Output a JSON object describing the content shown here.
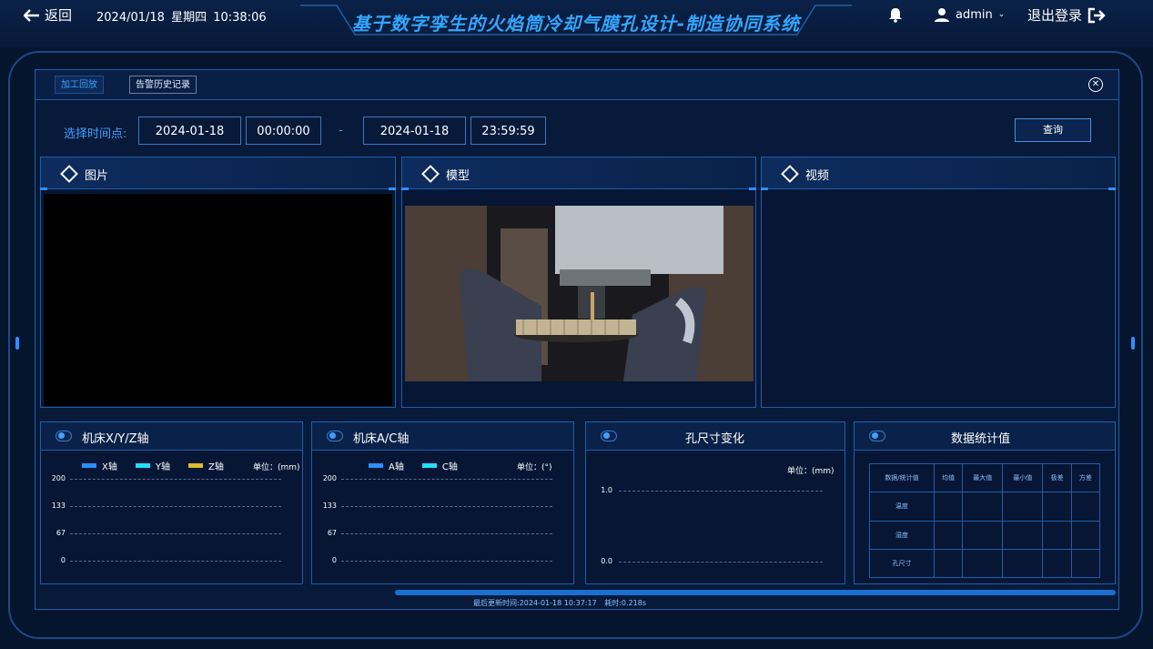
{
  "header": {
    "back_label": "返回",
    "date": "2024/01/18",
    "weekday": "星期四",
    "time": "10:38:06",
    "title": "基于数字孪生的火焰筒冷却气膜孔设计-制造协同系统",
    "user": "admin",
    "logout_label": "退出登录"
  },
  "tabs": {
    "active": "加工回放",
    "alarm": "告警历史记录"
  },
  "time_filter": {
    "label": "选择时间点:",
    "start_date": "2024-01-18",
    "start_time": "00:00:00",
    "separator": "-",
    "end_date": "2024-01-18",
    "end_time": "23:59:59",
    "query_label": "查询"
  },
  "cards": {
    "image": "图片",
    "model": "模型",
    "video": "视频"
  },
  "charts": {
    "xyz": {
      "title": "机床X/Y/Z轴",
      "unit": "单位：(mm)"
    },
    "ac": {
      "title": "机床A/C轴",
      "unit": "单位：(°)"
    },
    "hole": {
      "title": "孔尺寸变化",
      "unit": "单位：(mm)"
    },
    "stats": {
      "title": "数据统计值"
    }
  },
  "chart_data": [
    {
      "type": "line",
      "title": "机床X/Y/Z轴",
      "ylabel": "单位：(mm)",
      "ylim": [
        0,
        200
      ],
      "yticks": [
        200,
        133,
        67,
        0
      ],
      "series": [
        {
          "name": "X轴",
          "color": "#2b8fff",
          "values": []
        },
        {
          "name": "Y轴",
          "color": "#22e0ff",
          "values": []
        },
        {
          "name": "Z轴",
          "color": "#e0b830",
          "values": []
        }
      ],
      "grid": true,
      "legend": "top"
    },
    {
      "type": "line",
      "title": "机床A/C轴",
      "ylabel": "单位：(°)",
      "ylim": [
        0,
        200
      ],
      "yticks": [
        200,
        133,
        67,
        0
      ],
      "series": [
        {
          "name": "A轴",
          "color": "#2b8fff",
          "values": []
        },
        {
          "name": "C轴",
          "color": "#22e0ff",
          "values": []
        }
      ],
      "grid": true,
      "legend": "top"
    },
    {
      "type": "line",
      "title": "孔尺寸变化",
      "ylabel": "单位：(mm)",
      "ylim": [
        0,
        1
      ],
      "yticks": [
        "1.0",
        "0.0"
      ],
      "series": [],
      "grid": true
    },
    {
      "type": "table",
      "title": "数据统计值",
      "columns": [
        "数据/统计值",
        "均值",
        "最大值",
        "最小值",
        "极差",
        "方差"
      ],
      "rows": [
        [
          "温度",
          "",
          "",
          "",
          "",
          ""
        ],
        [
          "湿度",
          "",
          "",
          "",
          "",
          ""
        ],
        [
          "孔尺寸",
          "",
          "",
          "",
          "",
          ""
        ]
      ]
    }
  ],
  "footer": {
    "progress": 1.0,
    "updated": "最后更新时间:2024-01-18 10:37:17",
    "elapsed": "耗时:0.218s"
  }
}
